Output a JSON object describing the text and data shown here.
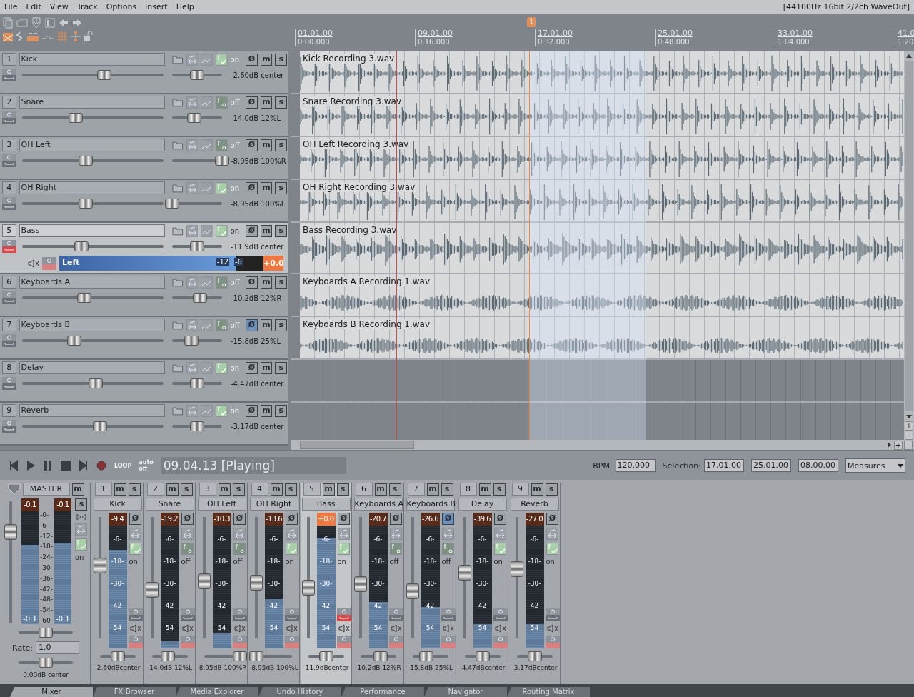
{
  "menu": [
    "File",
    "Edit",
    "View",
    "Track",
    "Options",
    "Insert",
    "Help"
  ],
  "status": "[44100Hz 16bit 2/2ch WaveOut]",
  "tracks": [
    {
      "number": "1",
      "name": "Kick",
      "fx_enabled": true,
      "fx_label": "on",
      "phase_label": "Ø",
      "mute_label": "m",
      "solo_label": "s",
      "phase": false,
      "armed": false,
      "selected": false,
      "volume": {
        "level": 0.58
      },
      "pan": {
        "level": 0.5
      },
      "reading": "-2.60dB center",
      "item": "Kick Recording 3.wav",
      "kind": "drums"
    },
    {
      "number": "2",
      "name": "Snare",
      "fx_enabled": false,
      "fx_label": "off",
      "phase_label": "Ø",
      "mute_label": "m",
      "solo_label": "s",
      "phase": false,
      "armed": false,
      "selected": false,
      "volume": {
        "level": 0.38
      },
      "pan": {
        "level": 0.44
      },
      "reading": "-14.0dB 12%L",
      "item": "Snare Recording 3.wav",
      "kind": "drums"
    },
    {
      "number": "3",
      "name": "OH Left",
      "fx_enabled": false,
      "fx_label": "off",
      "phase_label": "Ø",
      "mute_label": "m",
      "solo_label": "s",
      "phase": false,
      "armed": false,
      "selected": false,
      "volume": {
        "level": 0.45
      },
      "pan": {
        "level": 1
      },
      "reading": "-8.95dB 100%R",
      "item": "OH Left Recording 3.wav",
      "kind": "drums"
    },
    {
      "number": "4",
      "name": "OH Right",
      "fx_enabled": true,
      "fx_label": "on",
      "phase_label": "Ø",
      "mute_label": "m",
      "solo_label": "s",
      "phase": false,
      "armed": false,
      "selected": false,
      "volume": {
        "level": 0.45
      },
      "pan": {
        "level": 0
      },
      "reading": "-8.95dB 100%L",
      "item": "OH Right Recording 3.wav",
      "kind": "drums"
    },
    {
      "number": "5",
      "name": "Bass",
      "fx_enabled": true,
      "fx_label": "on",
      "phase_label": "Ø",
      "mute_label": "m",
      "solo_label": "s",
      "phase": false,
      "armed": true,
      "selected": true,
      "volume": {
        "level": 0.42
      },
      "pan": {
        "level": 0.5
      },
      "reading": "-11.9dB center",
      "item": "Bass Recording 3.wav",
      "kind": "bass",
      "input_meter": {
        "label": "Left",
        "level": 0.79,
        "marks": [
          "-12",
          "-6"
        ],
        "peak": "+0.0"
      }
    },
    {
      "number": "6",
      "name": "Keyboards A",
      "fx_enabled": false,
      "fx_label": "off",
      "phase_label": "Ø",
      "mute_label": "m",
      "solo_label": "s",
      "phase": false,
      "armed": false,
      "selected": false,
      "volume": {
        "level": 0.44
      },
      "pan": {
        "level": 0.56
      },
      "reading": "-10.2dB 12%R",
      "item": "Keyboards A Recording 1.wav",
      "kind": "keys"
    },
    {
      "number": "7",
      "name": "Keyboards B",
      "fx_enabled": false,
      "fx_label": "off",
      "phase_label": "Ø",
      "mute_label": "m",
      "solo_label": "s",
      "phase": true,
      "armed": false,
      "selected": false,
      "volume": {
        "level": 0.37
      },
      "pan": {
        "level": 0.38
      },
      "reading": "-15.8dB 25%L",
      "item": "Keyboards B Recording 1.wav",
      "kind": "keys"
    },
    {
      "number": "8",
      "name": "Delay",
      "fx_enabled": true,
      "fx_label": "on",
      "phase_label": "Ø",
      "mute_label": "m",
      "solo_label": "s",
      "phase": false,
      "armed": false,
      "selected": false,
      "volume": {
        "level": 0.52
      },
      "pan": {
        "level": 0.5
      },
      "reading": "-4.47dB center"
    },
    {
      "number": "9",
      "name": "Reverb",
      "fx_enabled": true,
      "fx_label": "on",
      "phase_label": "Ø",
      "mute_label": "m",
      "solo_label": "s",
      "phase": false,
      "armed": false,
      "selected": false,
      "volume": {
        "level": 0.55
      },
      "pan": {
        "level": 0.5
      },
      "reading": "-3.17dB center"
    }
  ],
  "ruler": {
    "region_marker": "1",
    "marks": [
      {
        "bar": "01.01.00",
        "time": "0:00.000"
      },
      {
        "bar": "09.01.00",
        "time": "0:16.000"
      },
      {
        "bar": "17.01.00",
        "time": "0:32.000"
      },
      {
        "bar": "25.01.00",
        "time": "0:48.000"
      },
      {
        "bar": "33.01.00",
        "time": "1:04.000"
      },
      {
        "bar": "41.0",
        "time": "1:20"
      }
    ]
  },
  "vertical_zoom": [
    "+",
    "-"
  ],
  "horizontal_zoom": [
    "+",
    "-"
  ],
  "transport": {
    "loop": "LOOP",
    "auto": "auto",
    "auto_state": "off",
    "position": "09.04.13 [Playing]",
    "bpm_label": "BPM:",
    "bpm": "120.000",
    "selection_label": "Selection:",
    "start": "17.01.00",
    "end": "25.01.00",
    "length": "08.00.00",
    "units": "Measures"
  },
  "master": {
    "name": "MASTER",
    "mute_label": "m",
    "solo_label": "s",
    "meters": [
      {
        "peak": "-0.1",
        "floor": "-0.1",
        "level": 0.7
      },
      {
        "peak": "-0.1",
        "floor": "-0.1",
        "level": 0.72
      }
    ],
    "scale": [
      "-0-",
      "-6-",
      "-12-",
      "-18-",
      "-24-",
      "-30-",
      "-36-",
      "-42-",
      "-48-",
      "-54-",
      "-60-"
    ],
    "fader": {
      "level": 0.75
    },
    "fx_label": "on",
    "fx_enabled": true,
    "pan": {
      "level": 0.5
    },
    "rate_label": "Rate:",
    "rate": "1.0",
    "stereo_width": {
      "level": 0.5
    },
    "reading": "0.00dB  center"
  },
  "strips": [
    {
      "number": "1",
      "name": "Kick",
      "peak": "-9.4",
      "clip": false,
      "meter": {
        "level": 0.8
      },
      "fader": {
        "level": 0.6
      },
      "pan": {
        "level": 0.5
      },
      "fx_enabled": true,
      "fx_label": "on",
      "phase_label": "Ø",
      "mute_label": "m",
      "solo_label": "s",
      "phase": false,
      "armed": false,
      "selected": false,
      "scale": [
        "-6-",
        "-18-",
        "-30-",
        "-42-",
        "-54-"
      ],
      "reading": "-2.60dBcenter"
    },
    {
      "number": "2",
      "name": "Snare",
      "peak": "-19.2",
      "clip": false,
      "meter": {
        "level": 0.06
      },
      "fader": {
        "level": 0.4
      },
      "pan": {
        "level": 0.44
      },
      "fx_enabled": false,
      "fx_label": "off",
      "phase_label": "Ø",
      "mute_label": "m",
      "solo_label": "s",
      "phase": false,
      "armed": false,
      "selected": false,
      "scale": [
        "-6-",
        "-18-",
        "-30-",
        "-42-",
        "-54-"
      ],
      "reading": "-14.0dB 12%L"
    },
    {
      "number": "3",
      "name": "OH Left",
      "peak": "-10.3",
      "clip": false,
      "meter": {
        "level": 0.12
      },
      "fader": {
        "level": 0.47
      },
      "pan": {
        "level": 1
      },
      "fx_enabled": false,
      "fx_label": "off",
      "phase_label": "Ø",
      "mute_label": "m",
      "solo_label": "s",
      "phase": false,
      "armed": false,
      "selected": false,
      "scale": [
        "-6-",
        "-18-",
        "-30-",
        "-42-",
        "-54-"
      ],
      "reading": "-8.95dB 100%R"
    },
    {
      "number": "4",
      "name": "OH Right",
      "peak": "-13.6",
      "clip": false,
      "meter": {
        "level": 0.4
      },
      "fader": {
        "level": 0.46
      },
      "pan": {
        "level": 0
      },
      "fx_enabled": true,
      "fx_label": "on",
      "phase_label": "Ø",
      "mute_label": "m",
      "solo_label": "s",
      "phase": false,
      "armed": false,
      "selected": false,
      "scale": [
        "-6-",
        "-18-",
        "-30-",
        "-42-",
        "-54-"
      ],
      "reading": "-8.95dB 100%L"
    },
    {
      "number": "5",
      "name": "Bass",
      "peak": "+0.0",
      "clip": true,
      "meter": {
        "level": 0.9
      },
      "fader": {
        "level": 0.42
      },
      "pan": {
        "level": 0.5
      },
      "fx_enabled": true,
      "fx_label": "on",
      "phase_label": "Ø",
      "mute_label": "m",
      "solo_label": "s",
      "phase": false,
      "armed": true,
      "selected": true,
      "scale": [
        "-6-",
        "-18-",
        "-30-",
        "-42-",
        "-54-"
      ],
      "reading": "-11.9dBcenter"
    },
    {
      "number": "6",
      "name": "Keyboards A",
      "peak": "-20.7",
      "clip": false,
      "meter": {
        "level": 0.38
      },
      "fader": {
        "level": 0.45
      },
      "pan": {
        "level": 0.56
      },
      "fx_enabled": false,
      "fx_label": "off",
      "phase_label": "Ø",
      "mute_label": "m",
      "solo_label": "s",
      "phase": false,
      "armed": false,
      "selected": false,
      "scale": [
        "-6-",
        "-18-",
        "-30-",
        "-42-",
        "-54-"
      ],
      "reading": "-10.2dB 12%R"
    },
    {
      "number": "7",
      "name": "Keyboards B",
      "peak": "-26.6",
      "clip": false,
      "meter": {
        "level": 0.34
      },
      "fader": {
        "level": 0.39
      },
      "pan": {
        "level": 0.38
      },
      "fx_enabled": false,
      "fx_label": "off",
      "phase_label": "Ø",
      "mute_label": "m",
      "solo_label": "s",
      "phase": true,
      "armed": false,
      "selected": false,
      "scale": [
        "-6-",
        "-18-",
        "-30-",
        "-42-",
        "-54-"
      ],
      "reading": "-15.8dB 25%L"
    },
    {
      "number": "8",
      "name": "Delay",
      "peak": "-39.6",
      "clip": false,
      "meter": {
        "level": 0.2
      },
      "fader": {
        "level": 0.54
      },
      "pan": {
        "level": 0.5
      },
      "fx_enabled": true,
      "fx_label": "on",
      "phase_label": "Ø",
      "mute_label": "m",
      "solo_label": "s",
      "phase": false,
      "armed": false,
      "selected": false,
      "scale": [
        "-6-",
        "-18-",
        "-30-",
        "-42-",
        "-54-"
      ],
      "reading": "-4.47dBcenter"
    },
    {
      "number": "9",
      "name": "Reverb",
      "peak": "-27.0",
      "clip": false,
      "meter": {
        "level": 0.2
      },
      "fader": {
        "level": 0.57
      },
      "pan": {
        "level": 0.5
      },
      "fx_enabled": true,
      "fx_label": "on",
      "phase_label": "Ø",
      "mute_label": "m",
      "solo_label": "s",
      "phase": false,
      "armed": false,
      "selected": false,
      "scale": [
        "-6-",
        "-18-",
        "-30-",
        "-42-",
        "-54-"
      ],
      "reading": "-3.17dBcenter"
    }
  ],
  "tabs": [
    {
      "label": "Mixer",
      "selected": true
    },
    {
      "label": "FX Browser",
      "selected": false
    },
    {
      "label": "Media Explorer",
      "selected": false
    },
    {
      "label": "Undo History",
      "selected": false
    },
    {
      "label": "Performance",
      "selected": false
    },
    {
      "label": "Navigator",
      "selected": false
    },
    {
      "label": "Routing Matrix",
      "selected": false
    }
  ]
}
